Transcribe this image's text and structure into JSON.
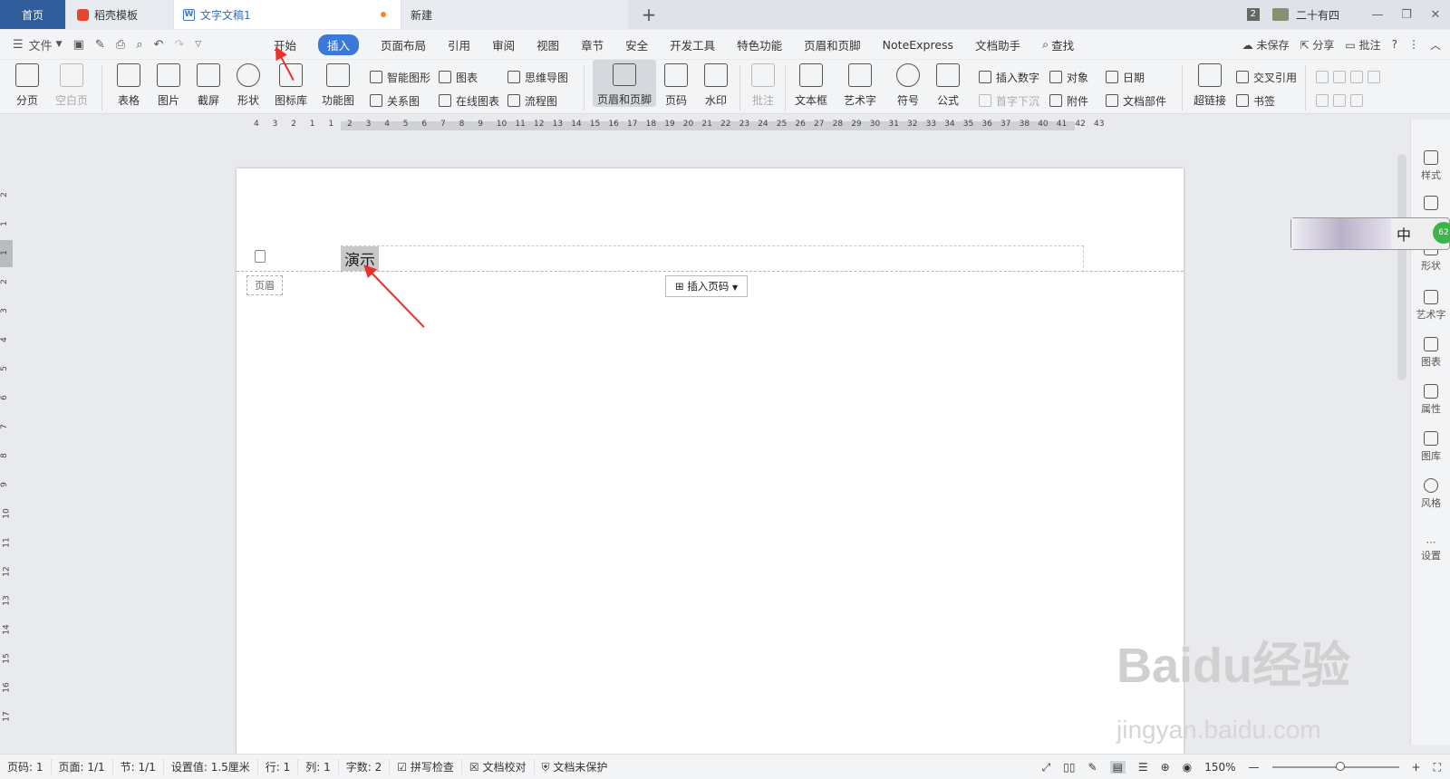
{
  "tabs": {
    "home": "首页",
    "docer": "稻壳模板",
    "doc": "文字文稿1",
    "new": "新建",
    "add": "+"
  },
  "titlebar": {
    "badge": "2",
    "user": "二十有四",
    "min": "—",
    "restore": "❐",
    "close": "✕"
  },
  "menu": {
    "file": "文件",
    "items": [
      "开始",
      "插入",
      "页面布局",
      "引用",
      "审阅",
      "视图",
      "章节",
      "安全",
      "开发工具",
      "特色功能",
      "页眉和页脚",
      "NoteExpress",
      "文档助手"
    ],
    "active": "插入",
    "search": "查找",
    "unsaved": "未保存",
    "share": "分享",
    "comment": "批注",
    "help": "?"
  },
  "ribbon": {
    "page_break": "分页",
    "blank_page": "空白页",
    "table": "表格",
    "picture": "图片",
    "screenshot": "截屏",
    "shape": "形状",
    "icon_lib": "图标库",
    "func_chart": "功能图",
    "smart_shape": "智能图形",
    "chart": "图表",
    "mindmap": "思维导图",
    "relation": "关系图",
    "online_chart": "在线图表",
    "flowchart": "流程图",
    "header_footer": "页眉和页脚",
    "page_number": "页码",
    "watermark": "水印",
    "comment": "批注",
    "textbox": "文本框",
    "wordart": "艺术字",
    "symbol": "符号",
    "formula": "公式",
    "insert_number": "插入数字",
    "object": "对象",
    "date": "日期",
    "drop_cap": "首字下沉",
    "attachment": "附件",
    "doc_parts": "文档部件",
    "hyperlink": "超链接",
    "cross_ref": "交叉引用",
    "bookmark": "书签"
  },
  "ruler": {
    "h_left": [
      "4",
      "3",
      "2",
      "1"
    ],
    "h_right": [
      "1",
      "2",
      "3",
      "4",
      "5",
      "6",
      "7",
      "8",
      "9",
      "10",
      "11",
      "12",
      "13",
      "14",
      "15",
      "16",
      "17",
      "18",
      "19",
      "20",
      "21",
      "22",
      "23",
      "24",
      "25",
      "26",
      "27",
      "28",
      "29",
      "30",
      "31",
      "32",
      "33",
      "34",
      "35",
      "36",
      "37",
      "38",
      "40",
      "41",
      "42",
      "43"
    ],
    "v": [
      "2",
      "1",
      "1",
      "2",
      "3",
      "4",
      "5",
      "6",
      "7",
      "8",
      "9",
      "10",
      "11",
      "12",
      "13",
      "14",
      "15",
      "16",
      "17"
    ]
  },
  "document": {
    "header_text": "演示",
    "header_label": "页眉",
    "insert_page_number": "插入页码"
  },
  "sidepanel": [
    "样式",
    "形状",
    "艺术字",
    "图表",
    "属性",
    "图库",
    "风格",
    "设置"
  ],
  "ime": {
    "mode": "中",
    "count": "62"
  },
  "watermark": {
    "main": "Baidu经验",
    "sub": "jingyan.baidu.com"
  },
  "status": {
    "page": "页码: 1",
    "pages": "页面: 1/1",
    "section": "节: 1/1",
    "setting": "设置值: 1.5厘米",
    "row": "行: 1",
    "col": "列: 1",
    "words": "字数: 2",
    "spell": "拼写检查",
    "proof": "文档校对",
    "protect": "文档未保护",
    "zoom": "150%"
  }
}
